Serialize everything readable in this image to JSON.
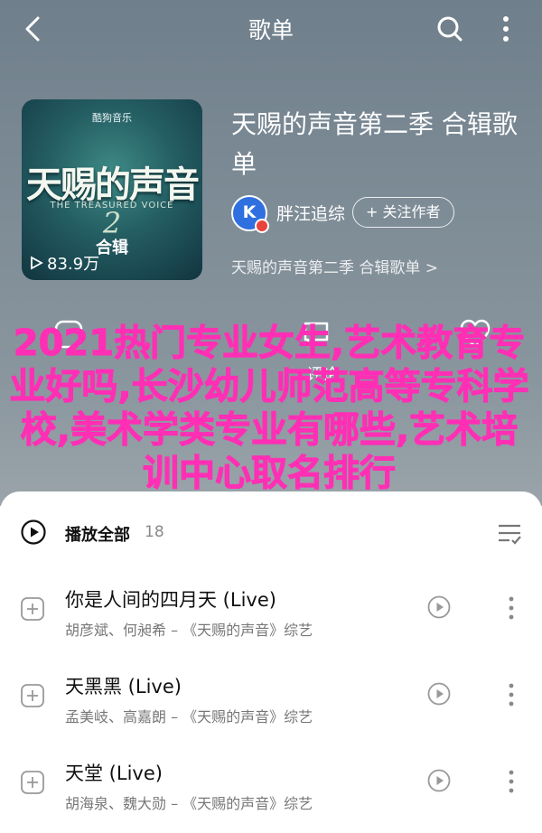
{
  "topbar": {
    "title": "歌单"
  },
  "album": {
    "cover": {
      "brand": "酷狗音乐",
      "logo": "天赐的声音",
      "logo_sub": "THE TREASURED VOICE",
      "numeral": "2",
      "edition": "合辑",
      "plays": "83.9万"
    },
    "title": "天赐的声音第二季  合辑歌单",
    "curator": {
      "avatar_letter": "K",
      "name": "胖汪追综",
      "follow_label": "+ 关注作者"
    },
    "source": "天赐的声音第二季 合辑歌单 >"
  },
  "actions": {
    "comment_label": "评论"
  },
  "overlay_text": "2021热门专业女生,艺术教育专业好吗,长沙幼儿师范高等专科学校,美术学类专业有哪些,艺术培训中心取名排行",
  "playall": {
    "label": "播放全部",
    "count": "18"
  },
  "songs": [
    {
      "name": "你是人间的四月天 (Live)",
      "meta": "胡彦斌、何昶希 – 《天赐的声音》综艺"
    },
    {
      "name": "天黑黑 (Live)",
      "meta": "孟美岐、高嘉朗 – 《天赐的声音》综艺"
    },
    {
      "name": "天堂 (Live)",
      "meta": "胡海泉、魏大勋 – 《天赐的声音》综艺"
    }
  ],
  "colors": {
    "overlay": "#ff2fb5",
    "header_bg": "#7f8d97",
    "avatar": "#2f6fe0"
  }
}
